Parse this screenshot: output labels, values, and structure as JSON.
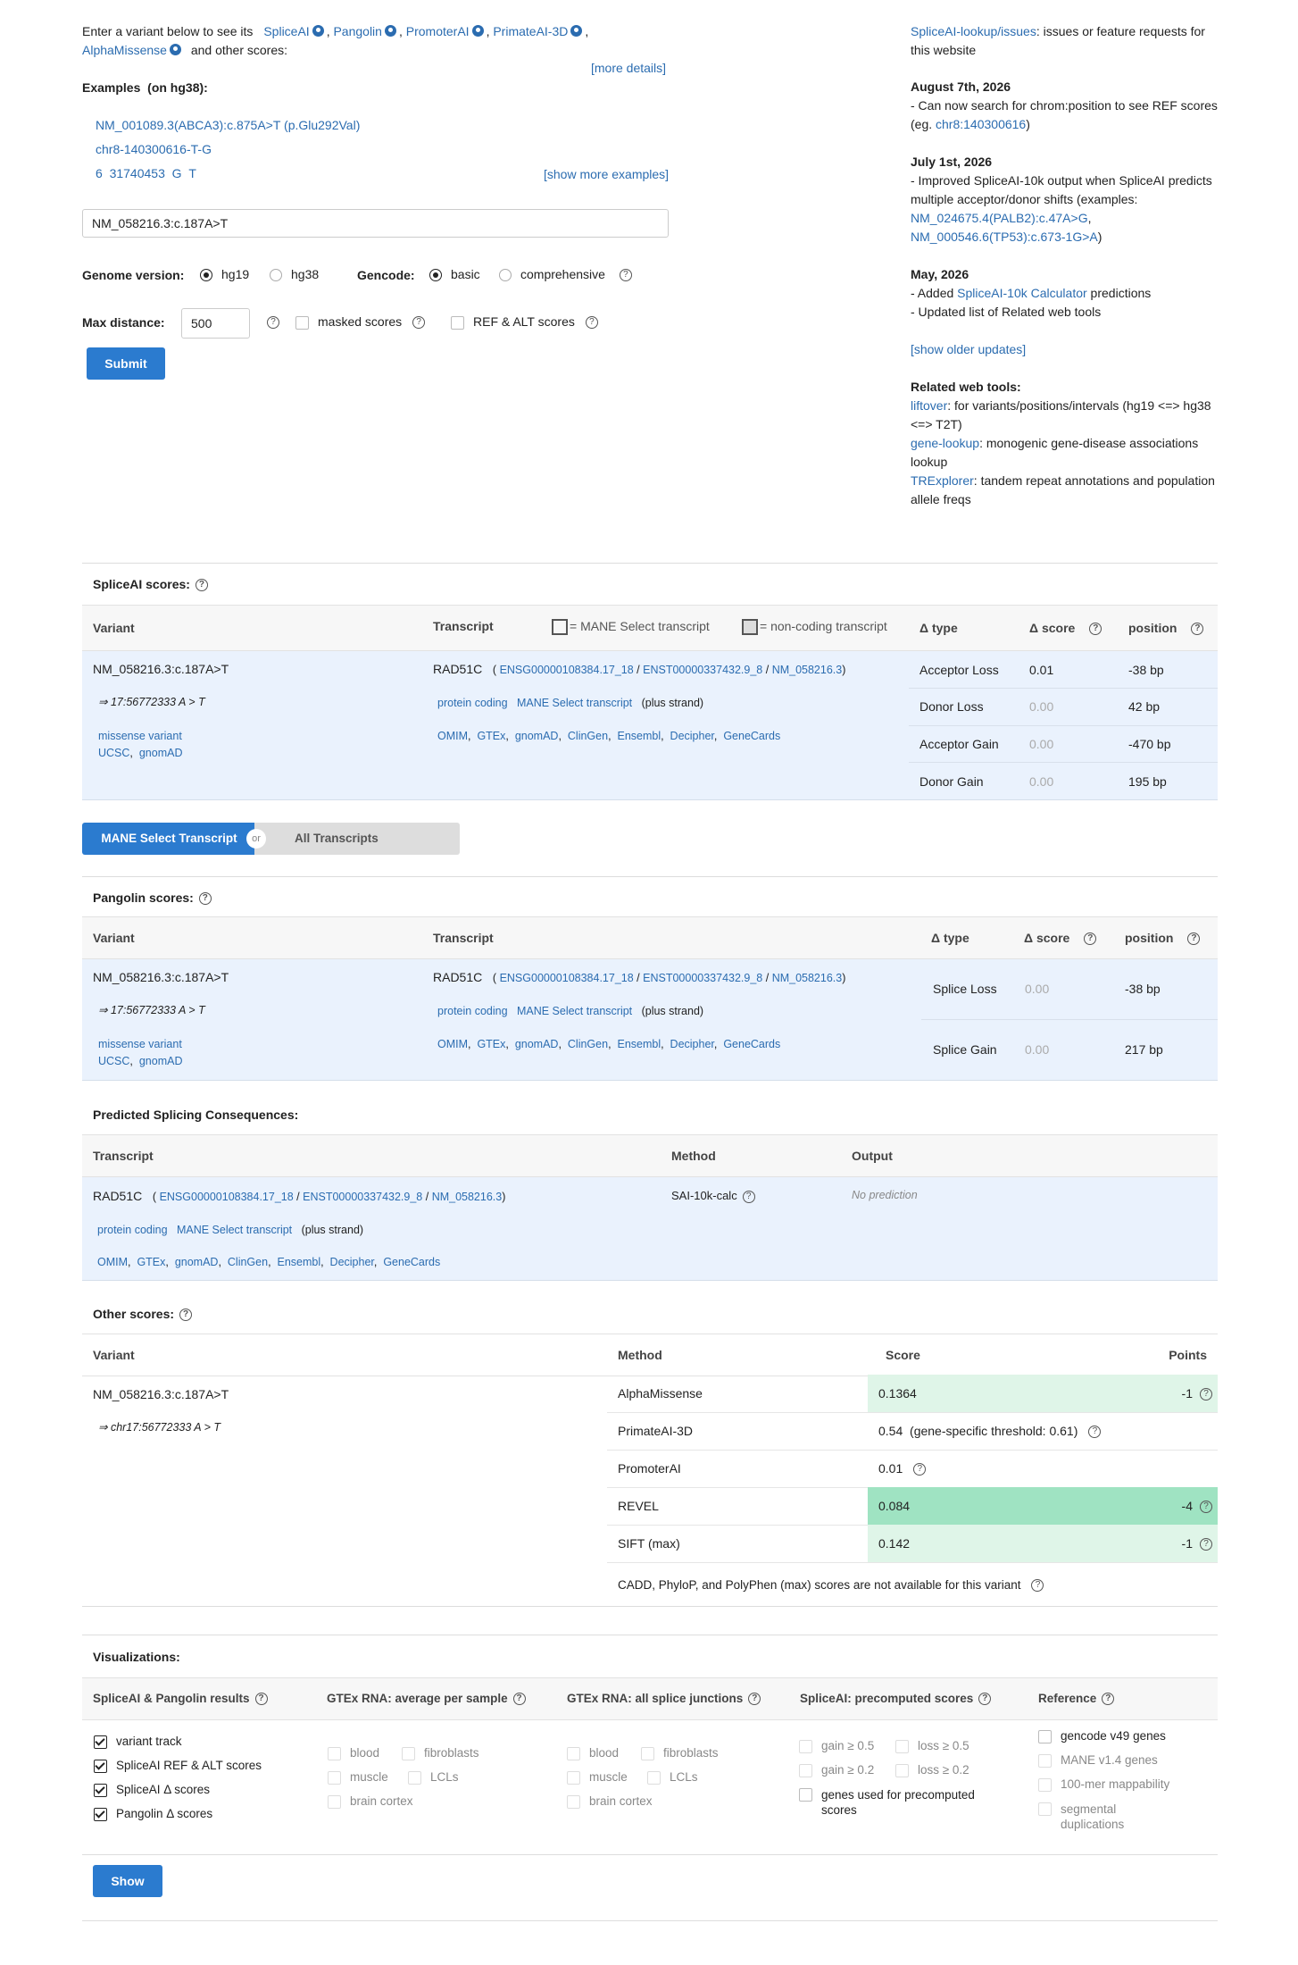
{
  "intro": {
    "prefix": "Enter a variant below to see its",
    "tools": [
      "SpliceAI",
      "Pangolin",
      "PromoterAI",
      "PrimateAI-3D",
      "AlphaMissense"
    ],
    "suffix": "and other scores:",
    "more_details": "[more details]"
  },
  "examples": {
    "title": "Examples",
    "subtitle": "(on hg38):",
    "items": [
      "NM_001089.3(ABCA3):c.875A>T (p.Glu292Val)",
      "chr8-140300616-T-G"
    ],
    "item3_chrom": "6",
    "item3_pos": "31740453",
    "item3_ref": "G",
    "item3_alt": "T",
    "show_more": "[show more examples]"
  },
  "search": {
    "value": "NM_058216.3:c.187A>T"
  },
  "options": {
    "genome_label": "Genome version:",
    "genome_options": [
      "hg19",
      "hg38"
    ],
    "genome_selected": "hg19",
    "gencode_label": "Gencode:",
    "gencode_options": [
      "basic",
      "comprehensive"
    ],
    "gencode_selected": "basic",
    "max_distance_label": "Max distance:",
    "max_distance_value": "500",
    "masked_label": "masked scores",
    "refalt_label": "REF & ALT scores",
    "submit": "Submit"
  },
  "news": {
    "issues_link": "SpliceAI-lookup/issues",
    "issues_text": ": issues or feature requests for this website",
    "updates": [
      {
        "date": "August 7th, 2026",
        "text": "- Can now search for chrom:position to see REF scores (eg. ",
        "link": "chr8:140300616",
        "tail": ")"
      },
      {
        "date": "July 1st, 2026",
        "text": "- Improved SpliceAI-10k output when SpliceAI predicts multiple acceptor/donor shifts (examples:",
        "link1": "NM_024675.4(PALB2):c.47A>G",
        "link2": "NM_000546.6(TP53):c.673-1G>A",
        "tail": ")"
      },
      {
        "date": "May, 2026",
        "text": "- Added ",
        "link": "SpliceAI-10k Calculator",
        "tail": " predictions",
        "text2": "- Updated list of Related web tools"
      }
    ],
    "show_older": "[show older updates]",
    "related_title": "Related web tools:",
    "related": [
      {
        "name": "liftover",
        "desc": ": for variants/positions/intervals (hg19 <=> hg38 <=> T2T)"
      },
      {
        "name": "gene-lookup",
        "desc": ": monogenic gene-disease associations lookup"
      },
      {
        "name": "TRExplorer",
        "desc": ": tandem repeat annotations and population allele freqs"
      }
    ]
  },
  "spliceai": {
    "title": "SpliceAI scores:",
    "headers": {
      "variant": "Variant",
      "transcript": "Transcript",
      "mane_legend": "= MANE Select transcript",
      "noncoding_legend": "= non-coding transcript",
      "delta_type": "Δ type",
      "delta_score": "Δ score",
      "position": "position"
    },
    "variant": "NM_058216.3:c.187A>T",
    "coords": "⇒ 17:56772333 A > T",
    "consequence": "missense variant",
    "links": [
      "UCSC",
      "gnomAD"
    ],
    "gene": "RAD51C",
    "ensg": "ENSG00000108384.17_18",
    "enst": "ENST00000337432.9_8",
    "nm": "NM_058216.3",
    "biotype": "protein coding",
    "mane": "MANE Select transcript",
    "strand": "(plus strand)",
    "ext_links": [
      "OMIM",
      "GTEx",
      "gnomAD",
      "ClinGen",
      "Ensembl",
      "Decipher",
      "GeneCards"
    ],
    "rows": [
      {
        "type": "Acceptor Loss",
        "score": "0.01",
        "pos": "-38 bp",
        "faint": false
      },
      {
        "type": "Donor Loss",
        "score": "0.00",
        "pos": "42 bp",
        "faint": true
      },
      {
        "type": "Acceptor Gain",
        "score": "0.00",
        "pos": "-470 bp",
        "faint": true
      },
      {
        "type": "Donor Gain",
        "score": "0.00",
        "pos": "195 bp",
        "faint": true
      }
    ]
  },
  "toggle": {
    "mane": "MANE Select Transcript",
    "or": "or",
    "all": "All Transcripts"
  },
  "pangolin": {
    "title": "Pangolin scores:",
    "headers": {
      "variant": "Variant",
      "transcript": "Transcript",
      "delta_type": "Δ type",
      "delta_score": "Δ score",
      "position": "position"
    },
    "coords": "⇒ 17:56772333 A > T",
    "rows": [
      {
        "type": "Splice Loss",
        "score": "0.00",
        "pos": "-38 bp"
      },
      {
        "type": "Splice Gain",
        "score": "0.00",
        "pos": "217 bp"
      }
    ]
  },
  "consequences": {
    "title": "Predicted Splicing Consequences:",
    "headers": {
      "transcript": "Transcript",
      "method": "Method",
      "output": "Output"
    },
    "method": "SAI-10k-calc",
    "output": "No prediction"
  },
  "other": {
    "title": "Other scores:",
    "headers": {
      "variant": "Variant",
      "method": "Method",
      "score": "Score",
      "points": "Points"
    },
    "variant": "NM_058216.3:c.187A>T",
    "coords": "⇒ chr17:56772333 A > T",
    "rows": [
      {
        "method": "AlphaMissense",
        "score": "0.1364",
        "points": "-1",
        "color": "#dff5e8"
      },
      {
        "method": "PrimateAI-3D",
        "score": "0.54",
        "extra": "(gene-specific threshold: 0.61)",
        "points": "",
        "color": ""
      },
      {
        "method": "PromoterAI",
        "score": "0.01",
        "points": "",
        "color": ""
      },
      {
        "method": "REVEL",
        "score": "0.084",
        "points": "-4",
        "color": "#9fe3c2"
      },
      {
        "method": "SIFT (max)",
        "score": "0.142",
        "points": "-1",
        "color": "#dff5e8"
      }
    ],
    "note": "CADD, PhyloP, and PolyPhen (max) scores are not available for this variant"
  },
  "viz": {
    "title": "Visualizations:",
    "cols": [
      "SpliceAI & Pangolin results",
      "GTEx RNA: average per sample",
      "GTEx RNA: all splice junctions",
      "SpliceAI: precomputed scores",
      "Reference"
    ],
    "splice_items": [
      "variant track",
      "SpliceAI REF & ALT scores",
      "SpliceAI Δ  scores",
      "Pangolin Δ  scores"
    ],
    "gtex_a": [
      "blood",
      "fibroblasts",
      "muscle",
      "LCLs",
      "brain cortex"
    ],
    "gtex_b": [
      "blood",
      "fibroblasts",
      "muscle",
      "LCLs",
      "brain cortex"
    ],
    "pre": [
      "gain ≥ 0.5",
      "loss ≥ 0.5",
      "gain ≥ 0.2",
      "loss ≥ 0.2"
    ],
    "pre_genes": "genes used for precomputed scores",
    "ref": [
      "gencode v49 genes",
      "MANE v1.4 genes",
      "100-mer mappability",
      "segmental duplications"
    ],
    "show": "Show"
  }
}
